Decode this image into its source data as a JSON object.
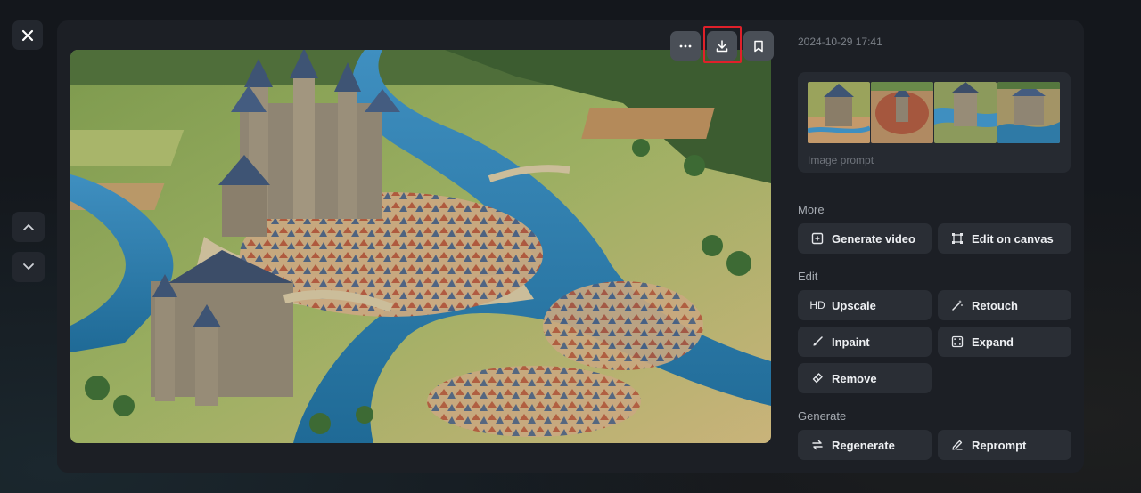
{
  "window": {
    "close_icon": "close-icon",
    "nav_up_icon": "chevron-up-icon",
    "nav_down_icon": "chevron-down-icon"
  },
  "toolbar": {
    "more_icon": "ellipsis-icon",
    "download_icon": "download-icon",
    "bookmark_icon": "bookmark-icon",
    "highlight_color": "#e0202a"
  },
  "details": {
    "timestamp": "2024-10-29 17:41",
    "image_prompt_label": "Image prompt"
  },
  "sections": {
    "more": {
      "title": "More",
      "items": [
        {
          "label": "Generate video",
          "icon": "video-add-icon"
        },
        {
          "label": "Edit on canvas",
          "icon": "canvas-icon"
        }
      ]
    },
    "edit": {
      "title": "Edit",
      "items": [
        {
          "label": "Upscale",
          "icon_text": "HD"
        },
        {
          "label": "Retouch",
          "icon": "magic-wand-icon"
        },
        {
          "label": "Inpaint",
          "icon": "brush-icon"
        },
        {
          "label": "Expand",
          "icon": "expand-icon"
        },
        {
          "label": "Remove",
          "icon": "eraser-icon"
        }
      ]
    },
    "generate": {
      "title": "Generate",
      "items": [
        {
          "label": "Regenerate",
          "icon": "refresh-icon"
        },
        {
          "label": "Reprompt",
          "icon": "pencil-icon"
        }
      ]
    }
  },
  "colors": {
    "background": "#14171c",
    "panel": "#1c1f25",
    "button": "#2a2e35",
    "text": "#eef0f3"
  }
}
